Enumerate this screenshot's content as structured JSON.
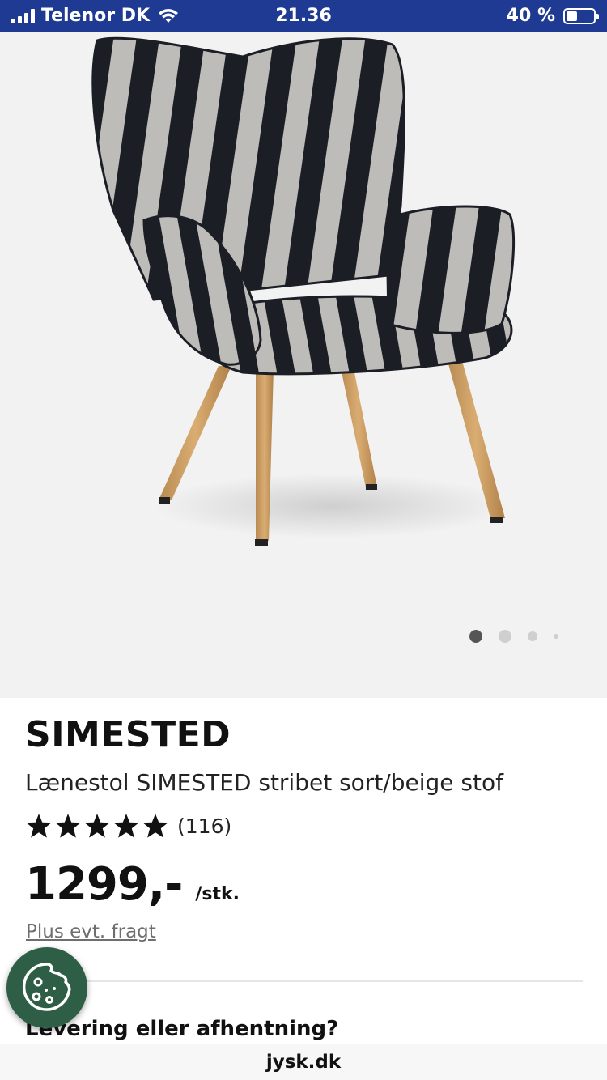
{
  "status_bar": {
    "carrier": "Telenor DK",
    "time": "21.36",
    "battery": "40 %",
    "battery_level": 0.4
  },
  "gallery": {
    "image_count": 4,
    "active_index": 0
  },
  "product": {
    "name": "SIMESTED",
    "description": "Lænestol SIMESTED stribet sort/beige stof",
    "rating": 5,
    "review_count": "(116)",
    "price": "1299,-",
    "price_unit": "/stk.",
    "shipping_link": "Plus evt. fragt"
  },
  "delivery": {
    "heading": "Levering eller afhentning?"
  },
  "browser": {
    "url": "jysk.dk"
  },
  "colors": {
    "status_bar": "#1f3a93",
    "cookie_button": "#2e5e45"
  }
}
